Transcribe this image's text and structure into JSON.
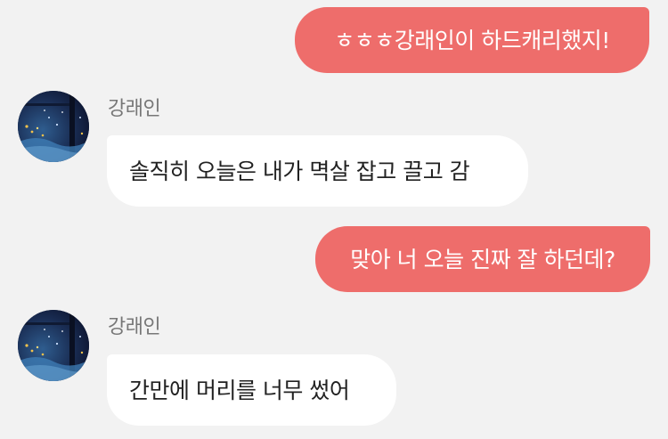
{
  "messages": [
    {
      "side": "out",
      "text": "ㅎㅎㅎ강래인이 하드캐리했지!"
    },
    {
      "side": "in",
      "sender": "강래인",
      "text": "솔직히 오늘은 내가 멱살 잡고 끌고 감"
    },
    {
      "side": "out",
      "text": "맞아 너 오늘 진짜 잘 하던데?"
    },
    {
      "side": "in",
      "sender": "강래인",
      "text": "간만에 머리를 너무 썼어"
    }
  ],
  "colors": {
    "background": "#f2f2f2",
    "outgoing_bubble": "#ee6d6b",
    "incoming_bubble": "#ffffff",
    "sender_name": "#777777"
  },
  "icons": {
    "avatar": "profile-photo-avatar"
  }
}
